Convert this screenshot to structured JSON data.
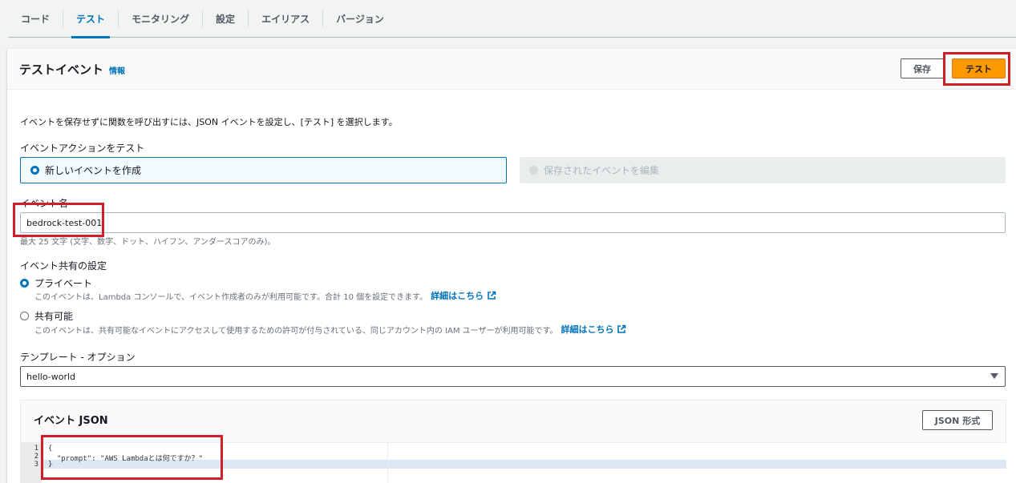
{
  "tabs": [
    "コード",
    "テスト",
    "モニタリング",
    "設定",
    "エイリアス",
    "バージョン"
  ],
  "active_tab": "テスト",
  "panel": {
    "title": "テストイベント",
    "info_link": "情報",
    "save_label": "保存",
    "test_label": "テスト"
  },
  "description": "イベントを保存せずに関数を呼び出すには、JSON イベントを設定し、[テスト] を選択します。",
  "event_action": {
    "label": "イベントアクションをテスト",
    "new_event": "新しいイベントを作成",
    "edit_saved": "保存されたイベントを編集"
  },
  "event_name": {
    "label": "イベント名",
    "value": "bedrock-test-001",
    "hint": "最大 25 文字 (文字、数字、ドット、ハイフン、アンダースコアのみ)。"
  },
  "sharing": {
    "label": "イベント共有の設定",
    "private_label": "プライベート",
    "private_desc": "このイベントは、Lambda コンソールで、イベント作成者のみが利用可能です。合計 10 個を設定できます。",
    "private_link": "詳細はこちら",
    "shareable_label": "共有可能",
    "shareable_desc": "このイベントは、共有可能なイベントにアクセスして使用するための許可が付与されている、同じアカウント内の IAM ユーザーが利用可能です。",
    "shareable_link": "詳細はこちら"
  },
  "template": {
    "label": "テンプレート - オプション",
    "value": "hello-world"
  },
  "event_json": {
    "title": "イベント JSON",
    "format_button": "JSON 形式",
    "line_numbers": [
      "1",
      "2",
      "3"
    ],
    "lines": [
      "{",
      "  \"prompt\": \"AWS Lambdaとは何ですか？\"",
      "}"
    ]
  },
  "colors": {
    "accent": "#0073bb",
    "primary_button": "#ff9900",
    "annotation": "#d11d2a"
  }
}
